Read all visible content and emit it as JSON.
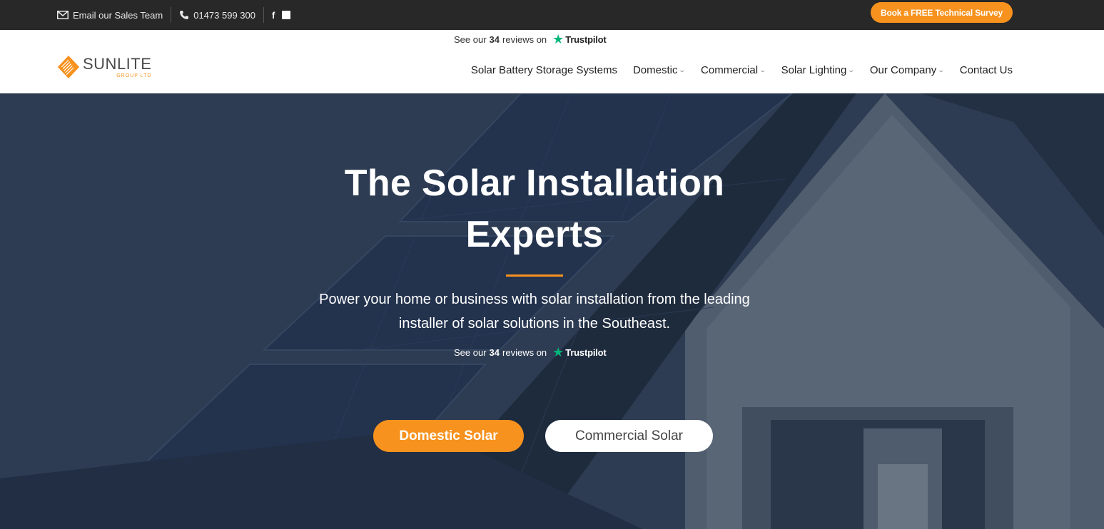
{
  "topbar": {
    "email_icon": "envelope-icon",
    "email_label": "Email our Sales Team",
    "phone_icon": "phone-icon",
    "phone_number": "01473 599 300",
    "facebook_icon": "facebook-icon",
    "facebook_glyph": "f",
    "linkedin_icon": "linkedin-icon",
    "linkedin_glyph": "in",
    "cta_label": "Book a FREE Technical Survey"
  },
  "trustpilot_header": {
    "prefix": "See our",
    "count": "34",
    "suffix": "reviews on",
    "star_icon": "trustpilot-star-icon",
    "brand": "Trustpilot"
  },
  "logo": {
    "name": "SUNLITE",
    "sub": "GROUP LTD"
  },
  "nav": {
    "items": [
      {
        "label": "Solar Battery Storage Systems"
      },
      {
        "label": "Domestic"
      },
      {
        "label": "Commercial"
      },
      {
        "label": "Solar Lighting"
      },
      {
        "label": "Our Company"
      },
      {
        "label": "Contact Us"
      }
    ],
    "chevron": "⌄"
  },
  "hero": {
    "title_line1": "The Solar Installation",
    "title_line2": "Experts",
    "subtitle_line1": "Power your home or business with solar installation from the leading",
    "subtitle_line2": "installer of solar solutions in the Southeast.",
    "trustpilot": {
      "prefix": "See our",
      "count": "34",
      "suffix": "reviews on",
      "brand": "Trustpilot"
    },
    "btn_domestic": "Domestic Solar",
    "btn_commercial": "Commercial Solar"
  },
  "colors": {
    "accent": "#f7921e",
    "topbar_bg": "#282828",
    "trustpilot_green": "#00b67a"
  }
}
